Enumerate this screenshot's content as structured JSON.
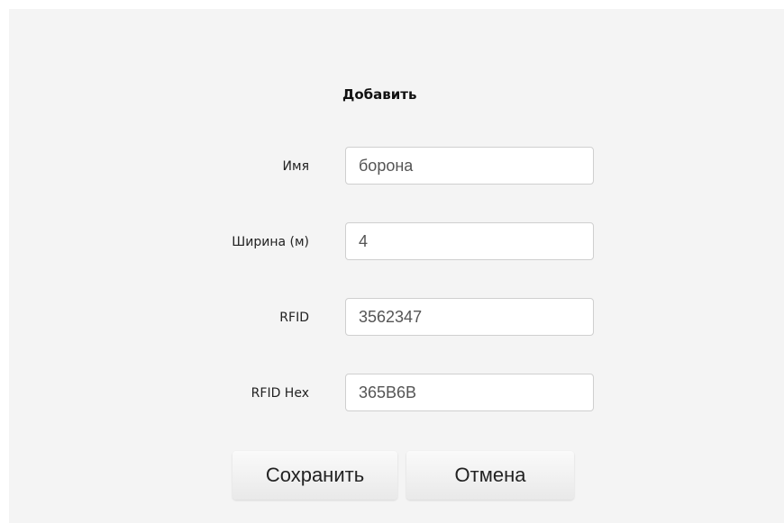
{
  "form": {
    "title": "Добавить",
    "fields": [
      {
        "label": "Имя",
        "value": "борона"
      },
      {
        "label": "Ширина (м)",
        "value": "4"
      },
      {
        "label": "RFID",
        "value": "3562347"
      },
      {
        "label": "RFID Hex",
        "value": "365B6B"
      }
    ]
  },
  "buttons": {
    "save_label": "Сохранить",
    "cancel_label": "Отмена"
  }
}
